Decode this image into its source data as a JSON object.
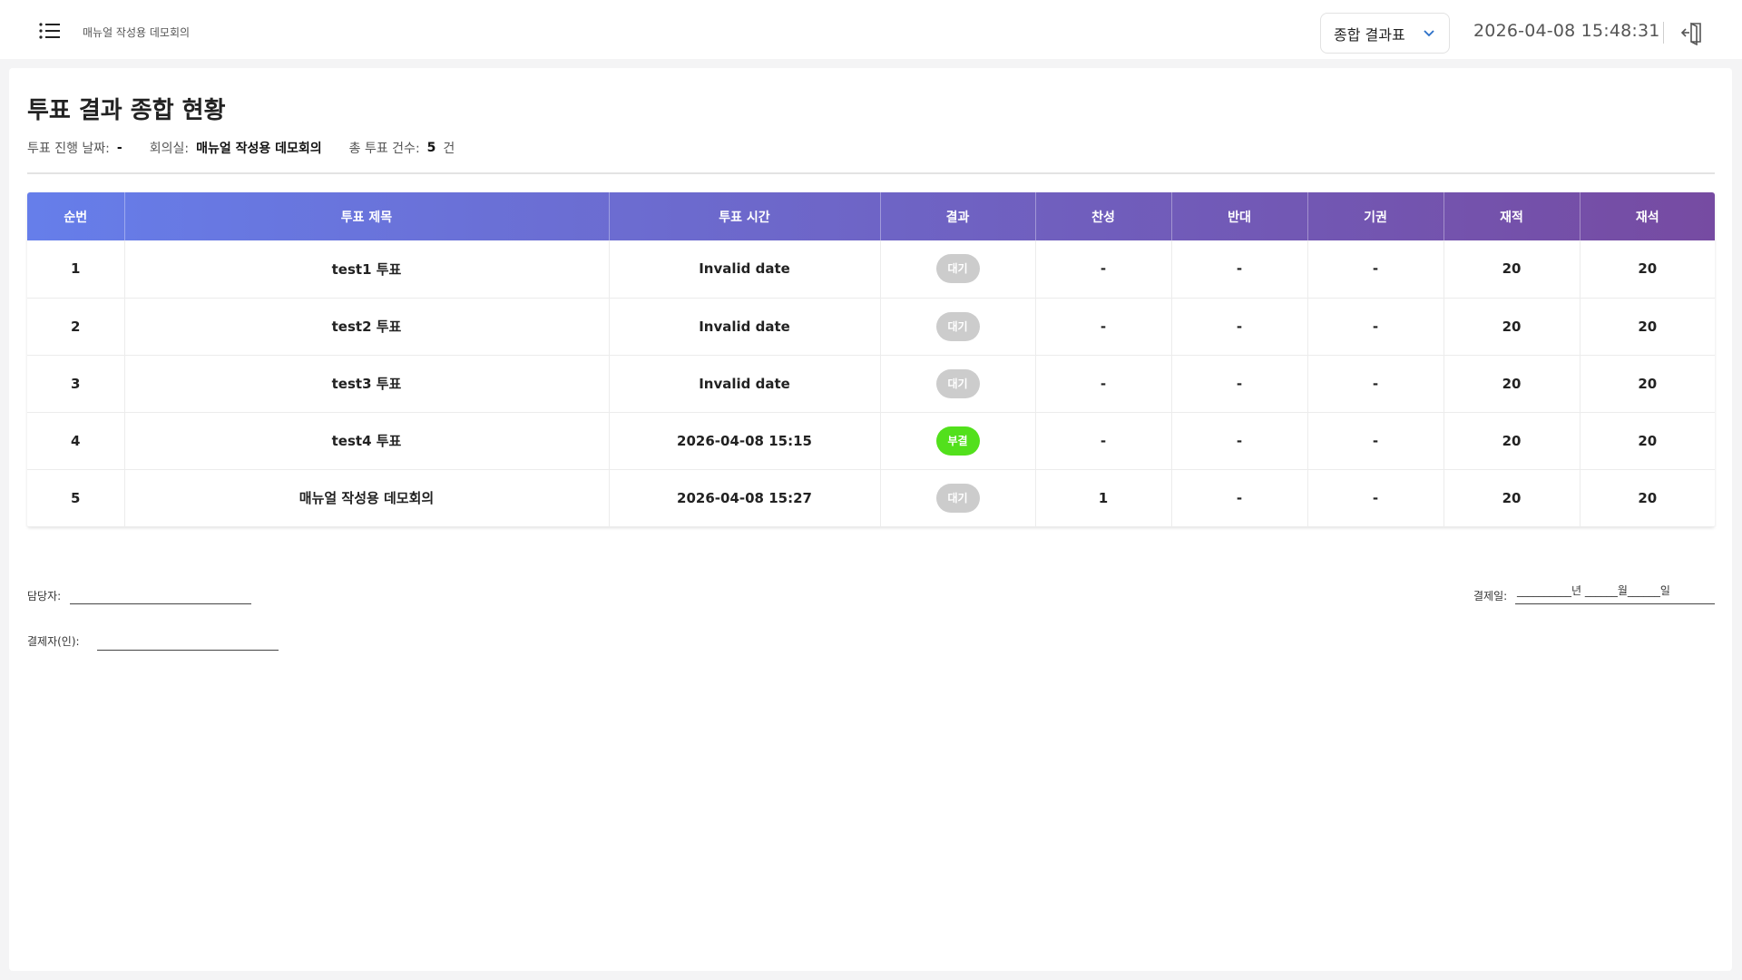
{
  "header": {
    "app_title": "매뉴얼 작성용 데모회의",
    "view_select_label": "종합 결과표",
    "datetime": "2026-04-08 15:48:31"
  },
  "page": {
    "title": "투표 결과 종합 현황",
    "meta": {
      "date_label": "투표 진행 날짜:",
      "date_value": "-",
      "room_label": "회의실:",
      "room_value": "매뉴얼 작성용 데모회의",
      "count_label": "총 투표 건수:",
      "count_value": "5",
      "count_unit": "건"
    }
  },
  "table": {
    "headers": [
      "순번",
      "투표 제목",
      "투표 시간",
      "결과",
      "찬성",
      "반대",
      "기권",
      "재적",
      "재석"
    ],
    "rows": [
      {
        "no": "1",
        "title": "test1 투표",
        "time": "Invalid date",
        "result": "대기",
        "result_status": "pending",
        "yes": "-",
        "no_votes": "-",
        "abstain": "-",
        "enrolled": "20",
        "present": "20"
      },
      {
        "no": "2",
        "title": "test2 투표",
        "time": "Invalid date",
        "result": "대기",
        "result_status": "pending",
        "yes": "-",
        "no_votes": "-",
        "abstain": "-",
        "enrolled": "20",
        "present": "20"
      },
      {
        "no": "3",
        "title": "test3 투표",
        "time": "Invalid date",
        "result": "대기",
        "result_status": "pending",
        "yes": "-",
        "no_votes": "-",
        "abstain": "-",
        "enrolled": "20",
        "present": "20"
      },
      {
        "no": "4",
        "title": "test4 투표",
        "time": "2026-04-08 15:15",
        "result": "부결",
        "result_status": "rejected",
        "yes": "-",
        "no_votes": "-",
        "abstain": "-",
        "enrolled": "20",
        "present": "20"
      },
      {
        "no": "5",
        "title": "매뉴얼 작성용 데모회의",
        "time": "2026-04-08 15:27",
        "result": "대기",
        "result_status": "pending",
        "yes": "1",
        "no_votes": "-",
        "abstain": "-",
        "enrolled": "20",
        "present": "20"
      }
    ]
  },
  "signatures": {
    "manager_label": "담당자:",
    "approver_label": "결제자(인):",
    "approval_date_label": "결제일:",
    "date_line": "__________년 ______월______일"
  },
  "colors": {
    "header_gradient_start": "#667eea",
    "header_gradient_end": "#764ba2",
    "badge_pending": "#cccccc",
    "badge_rejected": "#52e01c"
  }
}
